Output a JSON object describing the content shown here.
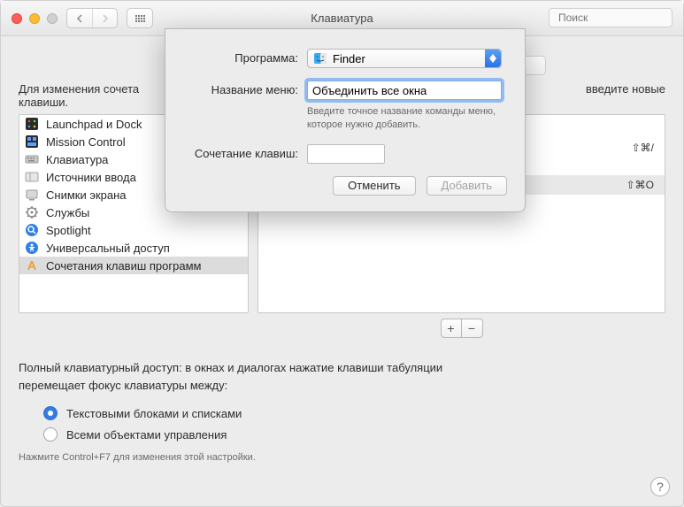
{
  "title": "Клавиатура",
  "search_placeholder": "Поиск",
  "instr_left": "Для изменения сочета",
  "instr_right": "введите новые",
  "instr_line_end": "клавиши.",
  "sidebar": [
    {
      "icon": "launchpad",
      "label": "Launchpad и Dock"
    },
    {
      "icon": "mission",
      "label": "Mission Control"
    },
    {
      "icon": "keyboard",
      "label": "Клавиатура"
    },
    {
      "icon": "input",
      "label": "Источники ввода"
    },
    {
      "icon": "screenshots",
      "label": "Снимки экрана"
    },
    {
      "icon": "services",
      "label": "Службы"
    },
    {
      "icon": "spotlight",
      "label": "Spotlight"
    },
    {
      "icon": "accessibility",
      "label": "Универсальный доступ"
    },
    {
      "icon": "appshortcuts",
      "label": "Сочетания клавиш программ"
    }
  ],
  "sidebar_selected_index": 8,
  "right_rows": [
    {
      "shortcut": "⇧⌘/"
    },
    {
      "shortcut": "⇧⌘O"
    }
  ],
  "plus": "+",
  "minus": "−",
  "bottom_text_1": "Полный клавиатурный доступ: в окнах и диалогах нажатие клавиши табуляции",
  "bottom_text_2": "перемещает фокус клавиатуры между:",
  "radio_1": "Текстовыми блоками и списками",
  "radio_2": "Всеми объектами управления",
  "radio_selected_index": 0,
  "hint": "Нажмите Control+F7 для изменения этой настройки.",
  "help_mark": "?",
  "sheet": {
    "app_label": "Программа:",
    "app_value": "Finder",
    "menu_label": "Название меню:",
    "menu_value": "Объединить все окна",
    "menu_help": "Введите точное название команды меню, которое нужно добавить.",
    "shortcut_label": "Сочетание клавиш:",
    "shortcut_value": "",
    "cancel": "Отменить",
    "add": "Добавить"
  }
}
